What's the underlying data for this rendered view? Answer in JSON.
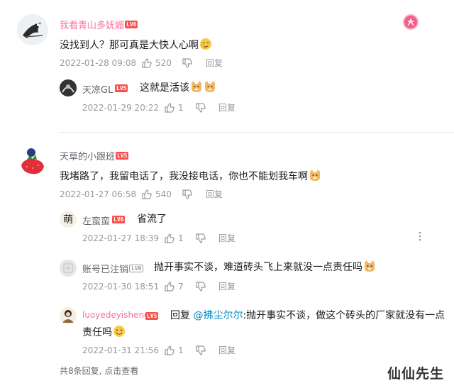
{
  "comments": [
    {
      "user": "我看青山多妩媚",
      "level": "LV6",
      "text": "没找到人？那可真是大快人心啊",
      "date": "2022-01-28 09:08",
      "likes": "520",
      "reply_label": "回复",
      "replies": [
        {
          "user": "天凉GL",
          "level": "LV5",
          "text": "这就是活该",
          "date": "2022-01-29 20:22",
          "likes": "1",
          "reply_label": "回复"
        }
      ]
    },
    {
      "user": "天草的小跟班",
      "level": "LV5",
      "text": "我堵路了，我留电话了，我没接电话，你也不能划我车啊",
      "date": "2022-01-27 06:58",
      "likes": "540",
      "reply_label": "回复",
      "replies": [
        {
          "user": "左蛮蛮",
          "level": "LV6",
          "text": "省流了",
          "date": "2022-01-27 18:39",
          "likes": "1",
          "reply_label": "回复"
        },
        {
          "user": "账号已注销",
          "level": "LV0",
          "text": "抛开事实不谈，难道砖头飞上来就没一点责任吗",
          "date": "2022-01-30 18:51",
          "likes": "7",
          "reply_label": "回复"
        },
        {
          "user": "luoyedeyisheng",
          "level": "LV5",
          "reply_prefix": "回复",
          "mention": "@拂尘尔尔",
          "text_line1": ":抛开事实不谈，做这个砖头的厂家就没有一点",
          "text_line2": "责任吗",
          "date": "2022-01-31 21:56",
          "likes": "1",
          "reply_label": "回复"
        }
      ],
      "total_replies": "共8条回复, 点击查看"
    }
  ],
  "watermark": "仙仙先生",
  "colors": {
    "username_vip": "#fb7299",
    "username": "#61666d",
    "mention": "#008ac5",
    "level_red": "#f6514d"
  }
}
